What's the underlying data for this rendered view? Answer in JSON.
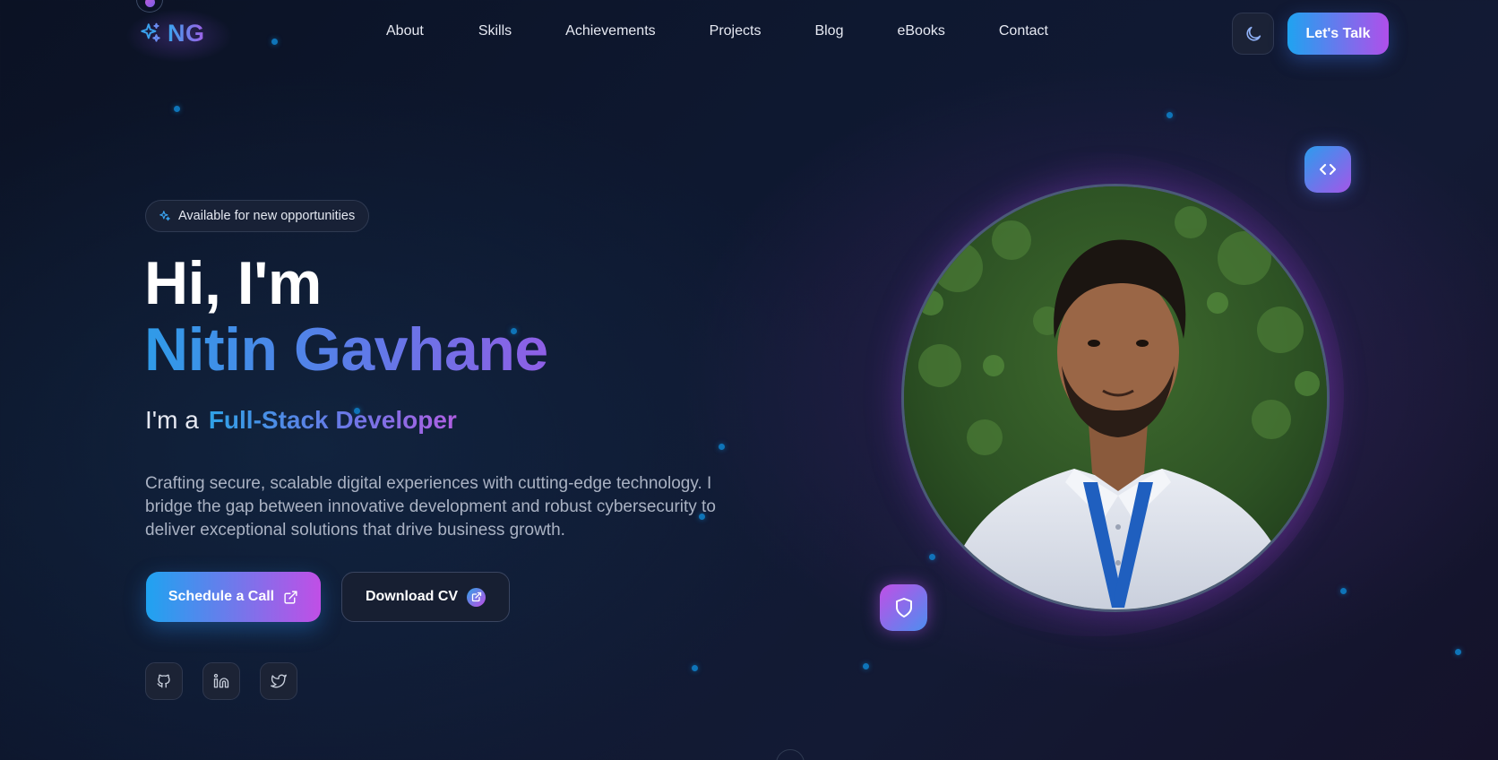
{
  "header": {
    "logo_text": "NG",
    "logo_icon": "sparkles-icon",
    "nav": [
      {
        "label": "About"
      },
      {
        "label": "Skills"
      },
      {
        "label": "Achievements"
      },
      {
        "label": "Projects"
      },
      {
        "label": "Blog"
      },
      {
        "label": "eBooks"
      },
      {
        "label": "Contact"
      }
    ],
    "theme_toggle_icon": "moon-icon",
    "cta_label": "Let's Talk"
  },
  "hero": {
    "badge": "Available for new opportunities",
    "greeting": "Hi, I'm",
    "name": "Nitin Gavhane",
    "role_prefix": "I'm a",
    "role": "Full-Stack Developer",
    "description": "Crafting secure, scalable digital experiences with cutting-edge technology. I bridge the gap between innovative development and robust cybersecurity to deliver exceptional solutions that drive business growth.",
    "primary_cta": "Schedule a Call",
    "secondary_cta": "Download CV",
    "socials": [
      {
        "icon": "github-icon"
      },
      {
        "icon": "linkedin-icon"
      },
      {
        "icon": "twitter-icon"
      }
    ],
    "floating_badges": [
      "code-icon",
      "shield-icon"
    ]
  },
  "colors": {
    "accent_blue": "#1fa3f0",
    "accent_purple": "#b04fea",
    "background": "#0e1830"
  }
}
